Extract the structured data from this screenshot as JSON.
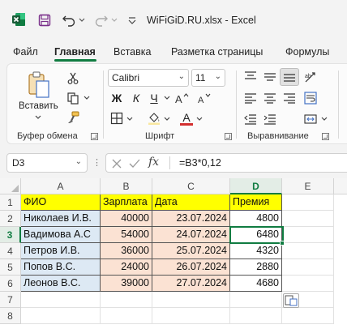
{
  "window": {
    "title": "WiFiGiD.RU.xlsx - Excel"
  },
  "tabs": [
    "Файл",
    "Главная",
    "Вставка",
    "Разметка страницы",
    "Формулы"
  ],
  "ribbon": {
    "clipboard": {
      "paste_label": "Вставить",
      "group_label": "Буфер обмена"
    },
    "font": {
      "font_name": "Calibri",
      "font_size": "11",
      "bold": "Ж",
      "italic": "К",
      "underline": "Ч",
      "font_color_letter": "A",
      "group_label": "Шрифт"
    },
    "alignment": {
      "group_label": "Выравнивание"
    }
  },
  "formula_bar": {
    "name_box": "D3",
    "fx": "fx",
    "formula": "=B3*0,12"
  },
  "columns": [
    "A",
    "B",
    "C",
    "D",
    "E"
  ],
  "rows": [
    "1",
    "2",
    "3",
    "4",
    "5",
    "6",
    "7",
    "8"
  ],
  "table": {
    "headers": [
      "ФИО",
      "Зарплата",
      "Дата",
      "Премия"
    ],
    "rows": [
      [
        "Николаев И.В.",
        "40000",
        "23.07.2024",
        "4800"
      ],
      [
        "Вадимова А.С",
        "54000",
        "24.07.2024",
        "6480"
      ],
      [
        "Петров И.В.",
        "36000",
        "25.07.2024",
        "4320"
      ],
      [
        "Попов В.С.",
        "24000",
        "26.07.2024",
        "2880"
      ],
      [
        "Леонов В.С.",
        "39000",
        "27.07.2024",
        "4680"
      ]
    ]
  },
  "colors": {
    "accent": "#107c41",
    "header_fill": "#ffff00",
    "name_fill": "#dde9f4",
    "value_fill": "#fbe2d3"
  }
}
